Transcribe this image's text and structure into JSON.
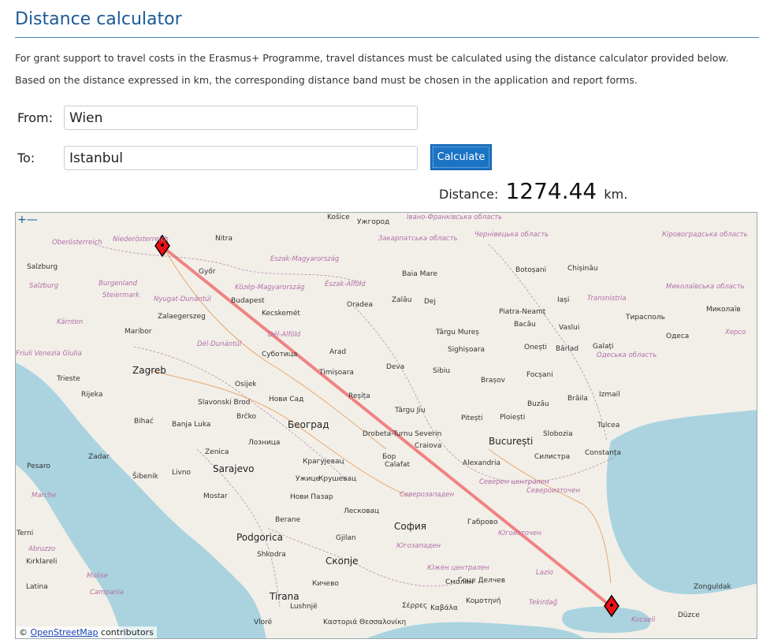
{
  "header": {
    "title": "Distance calculator"
  },
  "intro": {
    "line1": "For grant support to travel costs in the Erasmus+ Programme, travel distances must be calculated using the distance calculator provided below.",
    "line2": "Based on the distance expressed in km, the corresponding distance band must be chosen in the application and report forms."
  },
  "form": {
    "from_label": "From:",
    "from_value": "Wien",
    "to_label": "To:",
    "to_value": "Istanbul",
    "calculate_label": "Calculate"
  },
  "result": {
    "label": "Distance:",
    "value": "1274.44",
    "unit": "km."
  },
  "map": {
    "zoom_label": "+—",
    "attribution_prefix": "©",
    "attribution_link": "OpenStreetMap",
    "attribution_suffix": " contributors",
    "route_color": "#f07070",
    "marker_color": "#e11",
    "water_color": "#aad3df",
    "land_color": "#f2efe9",
    "places": [
      {
        "name": "Košice",
        "c": "city"
      },
      {
        "name": "Ужгород",
        "c": "city"
      },
      {
        "name": "Івано-Франківська область",
        "c": "reg"
      },
      {
        "name": "Oberösterreich",
        "c": "reg"
      },
      {
        "name": "Niederösterreich",
        "c": "reg"
      },
      {
        "name": "Nitra",
        "c": "city"
      },
      {
        "name": "Закарпатська область",
        "c": "reg"
      },
      {
        "name": "Чернівецька область",
        "c": "reg"
      },
      {
        "name": "Кіровоградська область",
        "c": "reg"
      },
      {
        "name": "Eszak-Magyarország",
        "c": "reg"
      },
      {
        "name": "Salzburg",
        "c": "city"
      },
      {
        "name": "Győr",
        "c": "city"
      },
      {
        "name": "Baia Mare",
        "c": "city"
      },
      {
        "name": "Botoșani",
        "c": "city"
      },
      {
        "name": "Chișinău",
        "c": "city"
      },
      {
        "name": "Burgenland",
        "c": "reg"
      },
      {
        "name": "Észak-Alföld",
        "c": "reg"
      },
      {
        "name": "Közép-Magyarország",
        "c": "reg"
      },
      {
        "name": "Salzburg",
        "c": "reg"
      },
      {
        "name": "Steiermark",
        "c": "reg"
      },
      {
        "name": "Transnistria",
        "c": "reg"
      },
      {
        "name": "Миколаївська область",
        "c": "reg"
      },
      {
        "name": "Nyugat-Dunántúl",
        "c": "reg"
      },
      {
        "name": "Budapest",
        "c": "city"
      },
      {
        "name": "Oradea",
        "c": "city"
      },
      {
        "name": "Zalău",
        "c": "city"
      },
      {
        "name": "Dej",
        "c": "city"
      },
      {
        "name": "Iași",
        "c": "city"
      },
      {
        "name": "Тирасполь",
        "c": "city"
      },
      {
        "name": "Миколаїв",
        "c": "city"
      },
      {
        "name": "Kecskemét",
        "c": "city"
      },
      {
        "name": "Zalaegerszeg",
        "c": "city"
      },
      {
        "name": "Kärnten",
        "c": "reg"
      },
      {
        "name": "Piatra-Neamț",
        "c": "city"
      },
      {
        "name": "Maribor",
        "c": "city"
      },
      {
        "name": "Bacău",
        "c": "city"
      },
      {
        "name": "Vaslui",
        "c": "city"
      },
      {
        "name": "Târgu Mureș",
        "c": "city"
      },
      {
        "name": "Dél-Alföld",
        "c": "reg"
      },
      {
        "name": "Одеса",
        "c": "city"
      },
      {
        "name": "Херсо",
        "c": "reg"
      },
      {
        "name": "Dél-Dunántúl",
        "c": "reg"
      },
      {
        "name": "Onești",
        "c": "city"
      },
      {
        "name": "Bârlad",
        "c": "city"
      },
      {
        "name": "Sighișoara",
        "c": "city"
      },
      {
        "name": "Friuli Venezia Giulia",
        "c": "reg"
      },
      {
        "name": "Arad",
        "c": "city"
      },
      {
        "name": "Galați",
        "c": "city"
      },
      {
        "name": "Суботица",
        "c": "city"
      },
      {
        "name": "Одеська область",
        "c": "reg"
      },
      {
        "name": "Zagreb",
        "c": "big"
      },
      {
        "name": "Deva",
        "c": "city"
      },
      {
        "name": "Sibiu",
        "c": "city"
      },
      {
        "name": "Timișoara",
        "c": "city"
      },
      {
        "name": "Trieste",
        "c": "city"
      },
      {
        "name": "Brașov",
        "c": "city"
      },
      {
        "name": "Focșani",
        "c": "city"
      },
      {
        "name": "Osijek",
        "c": "city"
      },
      {
        "name": "Rijeka",
        "c": "city"
      },
      {
        "name": "Izmail",
        "c": "city"
      },
      {
        "name": "Slavonski Brod",
        "c": "city"
      },
      {
        "name": "Нови Сад",
        "c": "city"
      },
      {
        "name": "Reșița",
        "c": "city"
      },
      {
        "name": "Brăila",
        "c": "city"
      },
      {
        "name": "Buzău",
        "c": "city"
      },
      {
        "name": "Târgu Jiu",
        "c": "city"
      },
      {
        "name": "Pitești",
        "c": "city"
      },
      {
        "name": "Ploiești",
        "c": "city"
      },
      {
        "name": "Bihać",
        "c": "city"
      },
      {
        "name": "Banja Luka",
        "c": "city"
      },
      {
        "name": "Brčko",
        "c": "city"
      },
      {
        "name": "Београд",
        "c": "big"
      },
      {
        "name": "Drobeta-Turnu Severin",
        "c": "city"
      },
      {
        "name": "Tulcea",
        "c": "city"
      },
      {
        "name": "Slobozia",
        "c": "city"
      },
      {
        "name": "Лозница",
        "c": "city"
      },
      {
        "name": "București",
        "c": "big"
      },
      {
        "name": "Craiova",
        "c": "city"
      },
      {
        "name": "Zenica",
        "c": "city"
      },
      {
        "name": "Крагујевац",
        "c": "city"
      },
      {
        "name": "Zadar",
        "c": "city"
      },
      {
        "name": "Силистра",
        "c": "city"
      },
      {
        "name": "Constanța",
        "c": "city"
      },
      {
        "name": "Бор",
        "c": "city"
      },
      {
        "name": "Alexandria",
        "c": "city"
      },
      {
        "name": "Calafat",
        "c": "city"
      },
      {
        "name": "Pesaro",
        "c": "city"
      },
      {
        "name": "Šibenik",
        "c": "city"
      },
      {
        "name": "Livno",
        "c": "city"
      },
      {
        "name": "Sarajevo",
        "c": "big"
      },
      {
        "name": "Ужице",
        "c": "city"
      },
      {
        "name": "Крушевац",
        "c": "city"
      },
      {
        "name": "Северен централен",
        "c": "reg"
      },
      {
        "name": "Северозападен",
        "c": "reg"
      },
      {
        "name": "Североизточен",
        "c": "reg"
      },
      {
        "name": "Marche",
        "c": "reg"
      },
      {
        "name": "Mostar",
        "c": "city"
      },
      {
        "name": "Нови Пазар",
        "c": "city"
      },
      {
        "name": "Лесковац",
        "c": "city"
      },
      {
        "name": "Габрово",
        "c": "city"
      },
      {
        "name": "Berane",
        "c": "city"
      },
      {
        "name": "София",
        "c": "big"
      },
      {
        "name": "Югоизточен",
        "c": "reg"
      },
      {
        "name": "Terni",
        "c": "city"
      },
      {
        "name": "Podgorica",
        "c": "big"
      },
      {
        "name": "Gjilan",
        "c": "city"
      },
      {
        "name": "Abruzzo",
        "c": "reg"
      },
      {
        "name": "Shkodra",
        "c": "city"
      },
      {
        "name": "Скопје",
        "c": "big"
      },
      {
        "name": "Югозападен",
        "c": "reg"
      },
      {
        "name": "Южен централен",
        "c": "reg"
      },
      {
        "name": "Lazio",
        "c": "reg"
      },
      {
        "name": "Kırklareli",
        "c": "city"
      },
      {
        "name": "Molise",
        "c": "reg"
      },
      {
        "name": "Смолян",
        "c": "city"
      },
      {
        "name": "Latina",
        "c": "city"
      },
      {
        "name": "Tirana",
        "c": "big"
      },
      {
        "name": "Кичево",
        "c": "city"
      },
      {
        "name": "Гоце Делчев",
        "c": "city"
      },
      {
        "name": "Zonguldak",
        "c": "city"
      },
      {
        "name": "Campania",
        "c": "reg"
      },
      {
        "name": "Lushnjë",
        "c": "city"
      },
      {
        "name": "Σέρρες",
        "c": "city"
      },
      {
        "name": "Καβάλα",
        "c": "city"
      },
      {
        "name": "Κομοτηνή",
        "c": "city"
      },
      {
        "name": "Tekirdağ",
        "c": "reg"
      },
      {
        "name": "Kocaeli",
        "c": "reg"
      },
      {
        "name": "Düzce",
        "c": "city"
      },
      {
        "name": "Vlorë",
        "c": "city"
      },
      {
        "name": "Καστοριά",
        "c": "city"
      },
      {
        "name": "Θεσσαλονίκη",
        "c": "city"
      },
      {
        "name": "Istanbul",
        "c": "city"
      }
    ]
  }
}
